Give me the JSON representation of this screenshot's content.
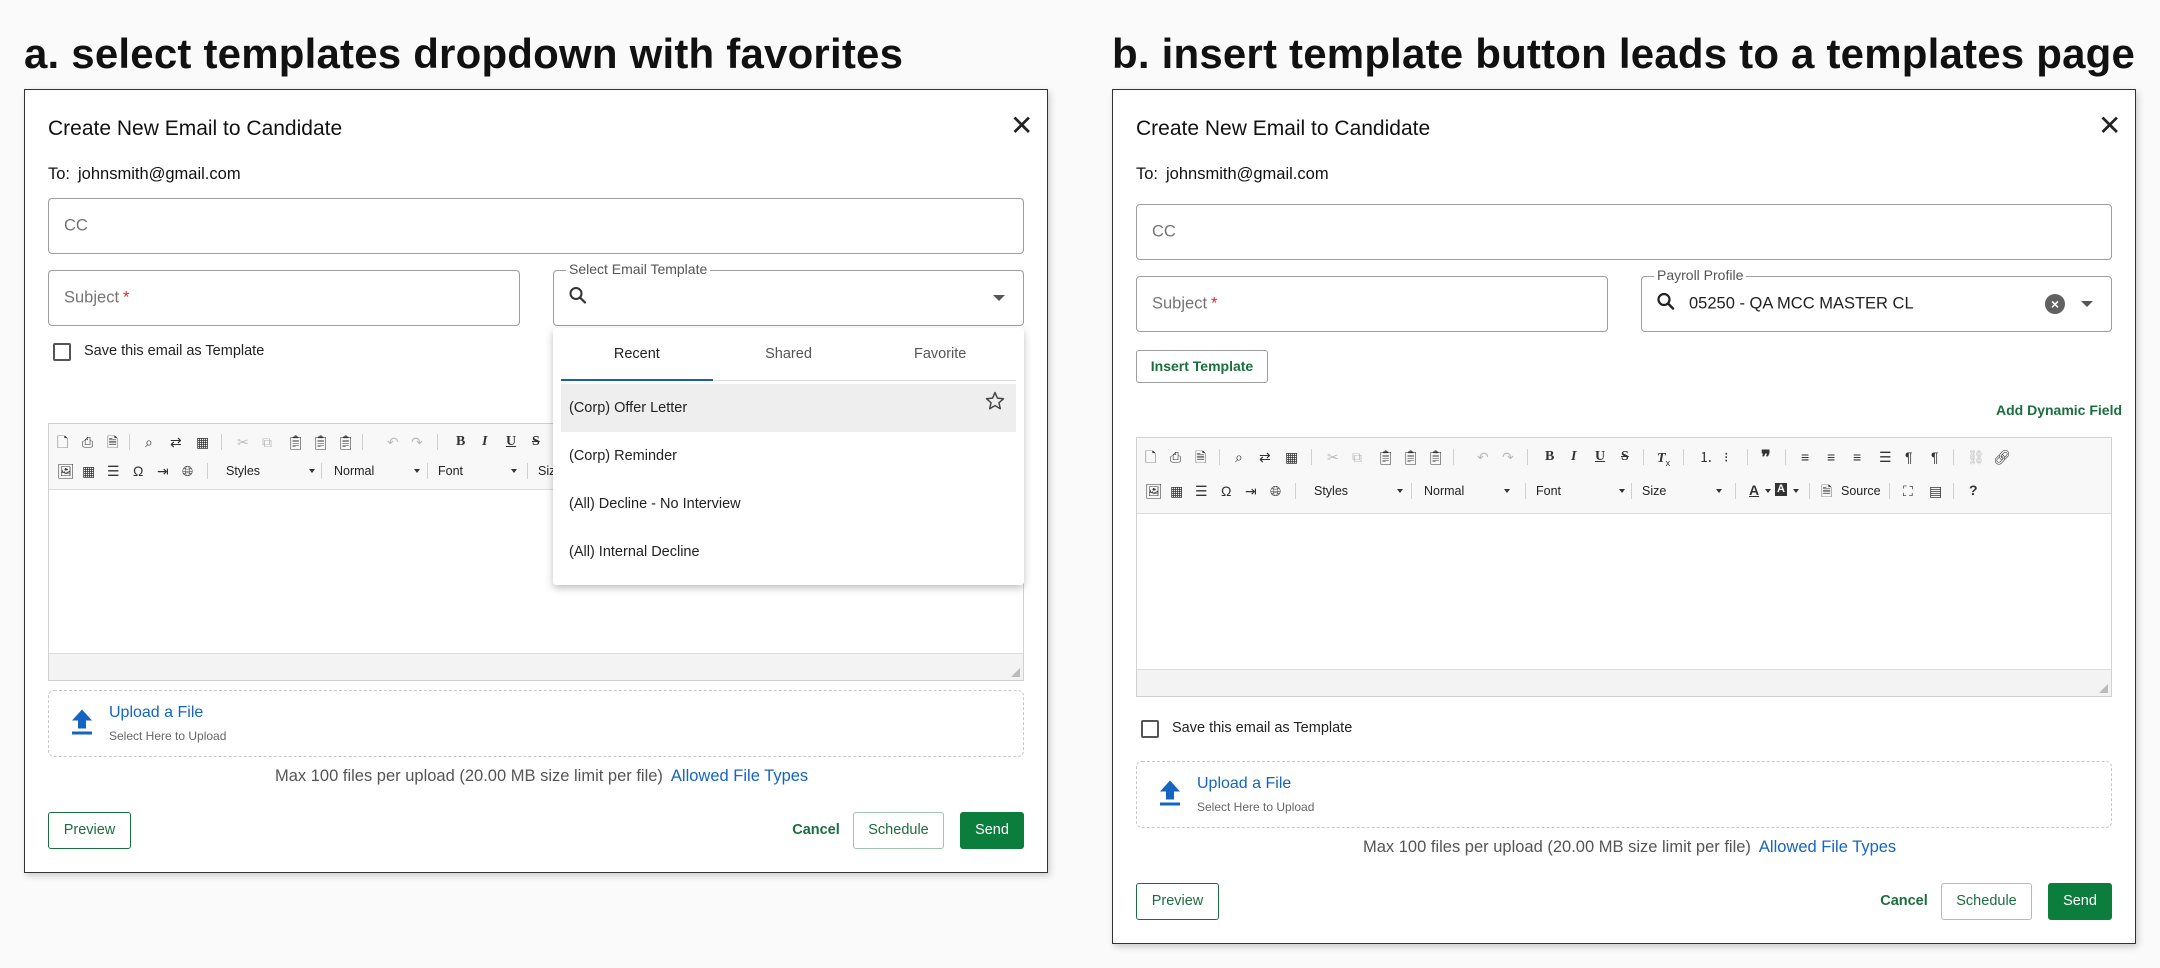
{
  "headings": {
    "a": "a. select templates dropdown with favorites",
    "b": "b. insert template button leads to a templates page"
  },
  "modal_a": {
    "title": "Create New Email to Candidate",
    "close_icon": "close-icon",
    "to_label": "To:",
    "to_value": "johnsmith@gmail.com",
    "cc_placeholder": "CC",
    "subject_placeholder": "Subject",
    "required_mark": "*",
    "template_select_label": "Select Email Template",
    "save_template_label": "Save this email as Template",
    "dropdown": {
      "tabs": [
        "Recent",
        "Shared",
        "Favorite"
      ],
      "active_tab": "Recent",
      "items": [
        "(Corp) Offer Letter",
        "(Corp) Reminder",
        "(All) Decline - No Interview",
        "(All) Internal Decline"
      ],
      "highlighted_item": "(Corp) Offer Letter"
    },
    "toolbar": {
      "styles": "Styles",
      "format": "Normal",
      "font": "Font",
      "size_partial": "Siz"
    },
    "upload": {
      "title": "Upload a File",
      "subtitle": "Select Here to Upload"
    },
    "limits_text": "Max 100 files per upload (20.00 MB size limit per file)",
    "allowed_link": "Allowed File Types",
    "buttons": {
      "preview": "Preview",
      "cancel": "Cancel",
      "schedule": "Schedule",
      "send": "Send"
    }
  },
  "modal_b": {
    "title": "Create New Email to Candidate",
    "close_icon": "close-icon",
    "to_label": "To:",
    "to_value": "johnsmith@gmail.com",
    "cc_placeholder": "CC",
    "subject_placeholder": "Subject",
    "required_mark": "*",
    "payroll_label": "Payroll Profile",
    "payroll_value": "05250 - QA MCC MASTER CL",
    "insert_template": "Insert Template",
    "add_dynamic_field": "Add Dynamic Field",
    "toolbar": {
      "styles": "Styles",
      "format": "Normal",
      "font": "Font",
      "size": "Size",
      "source": "Source",
      "help": "?"
    },
    "save_template_label": "Save this email as Template",
    "upload": {
      "title": "Upload a File",
      "subtitle": "Select Here to Upload"
    },
    "limits_text": "Max 100 files per upload (20.00 MB size limit per file)",
    "allowed_link": "Allowed File Types",
    "buttons": {
      "preview": "Preview",
      "cancel": "Cancel",
      "schedule": "Schedule",
      "send": "Send"
    }
  },
  "colors": {
    "primary_green": "#0b7d3c",
    "link_blue": "#1565c0",
    "required_red": "#d32f2f",
    "tab_underline": "#1f5fa8"
  }
}
